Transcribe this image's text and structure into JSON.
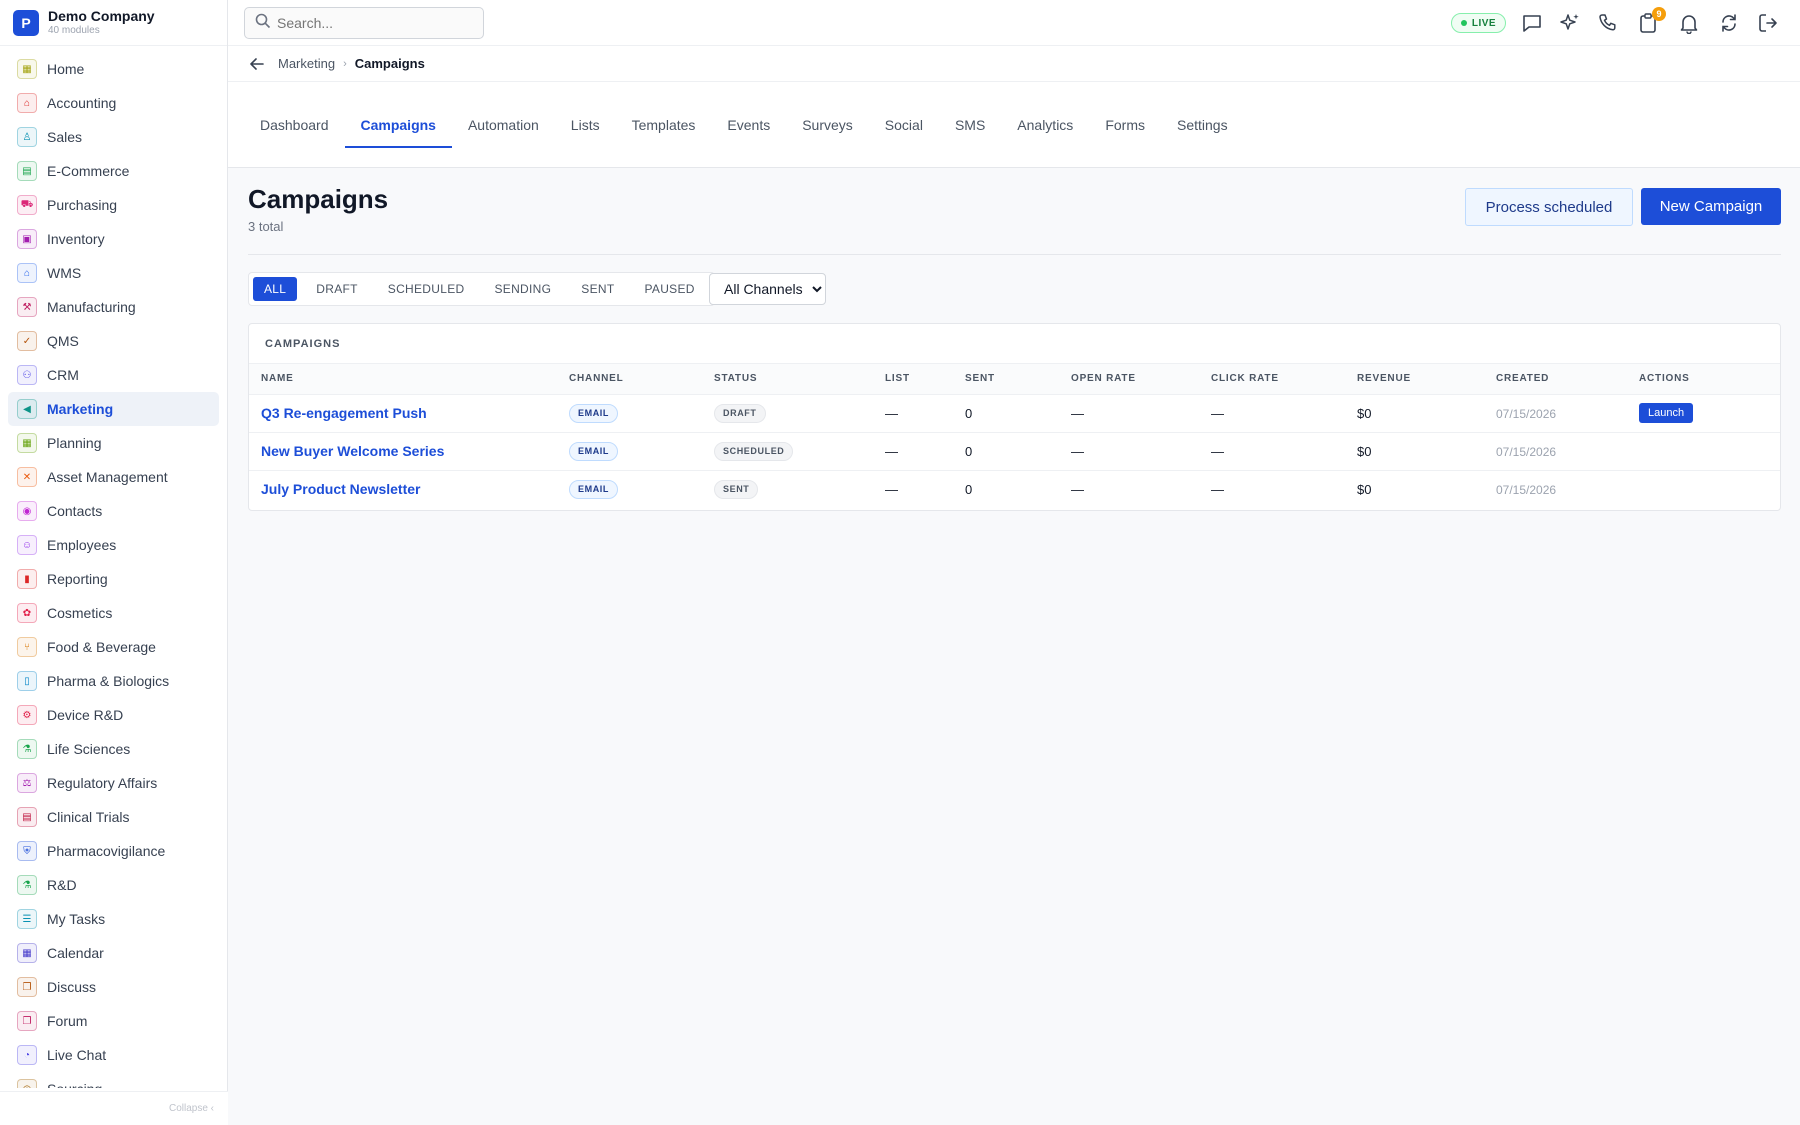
{
  "brand": {
    "logo_letter": "P",
    "name": "Demo Company",
    "subtitle": "40 modules"
  },
  "sidebar": {
    "items": [
      {
        "label": "Home",
        "icon": "grid-icon",
        "glyph": "▦",
        "color": "#a3a30f"
      },
      {
        "label": "Accounting",
        "icon": "bank-icon",
        "glyph": "⌂",
        "color": "#dc2626"
      },
      {
        "label": "Sales",
        "icon": "person-icon",
        "glyph": "♙",
        "color": "#0891b2"
      },
      {
        "label": "E-Commerce",
        "icon": "storefront-icon",
        "glyph": "▤",
        "color": "#16a34a"
      },
      {
        "label": "Purchasing",
        "icon": "cart-icon",
        "glyph": "⛟",
        "color": "#db2777"
      },
      {
        "label": "Inventory",
        "icon": "box-icon",
        "glyph": "▣",
        "color": "#a21caf"
      },
      {
        "label": "WMS",
        "icon": "warehouse-icon",
        "glyph": "⌂",
        "color": "#2563eb"
      },
      {
        "label": "Manufacturing",
        "icon": "factory-icon",
        "glyph": "⚒",
        "color": "#be185d"
      },
      {
        "label": "QMS",
        "icon": "badge-check-icon",
        "glyph": "✓",
        "color": "#b45309"
      },
      {
        "label": "CRM",
        "icon": "users-icon",
        "glyph": "⚇",
        "color": "#4f46e5"
      },
      {
        "label": "Marketing",
        "icon": "megaphone-icon",
        "glyph": "◀",
        "color": "#0d9488"
      },
      {
        "label": "Planning",
        "icon": "calendar-grid-icon",
        "glyph": "▦",
        "color": "#65a30d"
      },
      {
        "label": "Asset Management",
        "icon": "tools-icon",
        "glyph": "✕",
        "color": "#ea580c"
      },
      {
        "label": "Contacts",
        "icon": "contact-card-icon",
        "glyph": "◉",
        "color": "#c026d3"
      },
      {
        "label": "Employees",
        "icon": "id-badge-icon",
        "glyph": "☺",
        "color": "#9333ea"
      },
      {
        "label": "Reporting",
        "icon": "bar-chart-icon",
        "glyph": "▮",
        "color": "#dc2626"
      },
      {
        "label": "Cosmetics",
        "icon": "flower-icon",
        "glyph": "✿",
        "color": "#e11d48"
      },
      {
        "label": "Food & Beverage",
        "icon": "utensils-icon",
        "glyph": "⑂",
        "color": "#d97706"
      },
      {
        "label": "Pharma & Biologics",
        "icon": "pill-bottle-icon",
        "glyph": "▯",
        "color": "#0284c7"
      },
      {
        "label": "Device R&D",
        "icon": "chip-icon",
        "glyph": "⚙",
        "color": "#e11d48"
      },
      {
        "label": "Life Sciences",
        "icon": "microscope-icon",
        "glyph": "⚗",
        "color": "#16a34a"
      },
      {
        "label": "Regulatory Affairs",
        "icon": "gavel-icon",
        "glyph": "⚖",
        "color": "#a21caf"
      },
      {
        "label": "Clinical Trials",
        "icon": "clipboard-icon",
        "glyph": "▤",
        "color": "#be123c"
      },
      {
        "label": "Pharmacovigilance",
        "icon": "shield-icon",
        "glyph": "⛨",
        "color": "#1d4ed8"
      },
      {
        "label": "R&D",
        "icon": "flask-icon",
        "glyph": "⚗",
        "color": "#16a34a"
      },
      {
        "label": "My Tasks",
        "icon": "checklist-icon",
        "glyph": "☰",
        "color": "#0891b2"
      },
      {
        "label": "Calendar",
        "icon": "calendar-icon",
        "glyph": "▦",
        "color": "#4338ca"
      },
      {
        "label": "Discuss",
        "icon": "chat-bubbles-icon",
        "glyph": "❐",
        "color": "#b45309"
      },
      {
        "label": "Forum",
        "icon": "forum-icon",
        "glyph": "❐",
        "color": "#be185d"
      },
      {
        "label": "Live Chat",
        "icon": "headset-icon",
        "glyph": "◔",
        "color": "#4f46e5"
      },
      {
        "label": "Sourcing",
        "icon": "compass-icon",
        "glyph": "◎",
        "color": "#a16207"
      }
    ],
    "active_index": 10,
    "collapse_label": "Collapse ‹"
  },
  "topbar": {
    "search_placeholder": "Search...",
    "live_label": "LIVE",
    "icons": [
      {
        "name": "chat-icon"
      },
      {
        "name": "sparkles-icon"
      },
      {
        "name": "phone-icon"
      },
      {
        "name": "clipboard-notifications-icon",
        "badge": "9"
      },
      {
        "name": "bell-icon"
      },
      {
        "name": "sync-icon"
      },
      {
        "name": "logout-icon"
      }
    ]
  },
  "breadcrumb": {
    "parent": "Marketing",
    "separator": "›",
    "current": "Campaigns"
  },
  "tabs": [
    "Dashboard",
    "Campaigns",
    "Automation",
    "Lists",
    "Templates",
    "Events",
    "Surveys",
    "Social",
    "SMS",
    "Analytics",
    "Forms",
    "Settings"
  ],
  "active_tab": 1,
  "page": {
    "title": "Campaigns",
    "subtitle": "3 total",
    "process_button": "Process scheduled",
    "new_button": "New Campaign"
  },
  "filters": {
    "statuses": [
      "ALL",
      "DRAFT",
      "SCHEDULED",
      "SENDING",
      "SENT",
      "PAUSED"
    ],
    "active": 0,
    "channel_selected": "All Channels"
  },
  "table": {
    "title": "CAMPAIGNS",
    "columns": [
      "NAME",
      "CHANNEL",
      "STATUS",
      "LIST",
      "SENT",
      "OPEN RATE",
      "CLICK RATE",
      "REVENUE",
      "CREATED",
      "ACTIONS"
    ],
    "rows": [
      {
        "name": "Q3 Re-engagement Push",
        "channel": "EMAIL",
        "status": "DRAFT",
        "list": "—",
        "sent": "0",
        "open_rate": "—",
        "click_rate": "—",
        "revenue": "$0",
        "created": "07/15/2026",
        "action": "Launch"
      },
      {
        "name": "New Buyer Welcome Series",
        "channel": "EMAIL",
        "status": "SCHEDULED",
        "list": "—",
        "sent": "0",
        "open_rate": "—",
        "click_rate": "—",
        "revenue": "$0",
        "created": "07/15/2026",
        "action": ""
      },
      {
        "name": "July Product Newsletter",
        "channel": "EMAIL",
        "status": "SENT",
        "list": "—",
        "sent": "0",
        "open_rate": "—",
        "click_rate": "—",
        "revenue": "$0",
        "created": "07/15/2026",
        "action": ""
      }
    ]
  },
  "colors": {
    "accent": "#1d4ed8",
    "live_green": "#22c55e",
    "badge_orange": "#f59e0b"
  }
}
